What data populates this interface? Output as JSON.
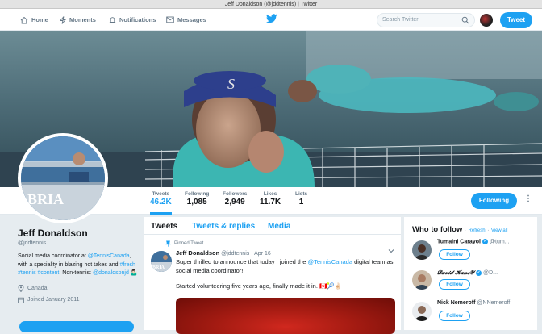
{
  "window": {
    "title": "Jeff Donaldson (@jddtennis) | Twitter"
  },
  "nav": {
    "home": "Home",
    "moments": "Moments",
    "notifications": "Notifications",
    "messages": "Messages",
    "search_placeholder": "Search Twitter",
    "tweet_button": "Tweet"
  },
  "stats": [
    {
      "label": "Tweets",
      "value": "46.2K"
    },
    {
      "label": "Following",
      "value": "1,085"
    },
    {
      "label": "Followers",
      "value": "2,949"
    },
    {
      "label": "Likes",
      "value": "11.7K"
    },
    {
      "label": "Lists",
      "value": "1"
    }
  ],
  "actions": {
    "following": "Following",
    "more": "⋮"
  },
  "profile": {
    "name": "Jeff Donaldson",
    "handle": "@jddtennis",
    "bio_1": "Social media coordinator at ",
    "bio_link_1": "@TennisCanada",
    "bio_2": ", with a speciality in blazing hot takes and ",
    "bio_link_2": "#fresh #tennis #content",
    "bio_3": ". Non-tennis: ",
    "bio_link_3": "@donaldsonjd",
    "bio_emoji": "🤷🏻‍♂️",
    "location": "Canada",
    "joined": "Joined January 2011",
    "banner_logo": "BRIA"
  },
  "timeline": {
    "tabs": [
      "Tweets",
      "Tweets & replies",
      "Media"
    ],
    "pinned_label": "Pinned Tweet",
    "tweet": {
      "name": "Jeff Donaldson",
      "handle": "@jddtennis",
      "date": "· Apr 16",
      "text_1": "Super thrilled to announce that today I joined the ",
      "text_link": "@TennisCanada",
      "text_2": " digital team as social media coordinator!",
      "text_3": "Started volunteering five years ago, finally made it in. 🇨🇦🎾✌🏻",
      "avatar_logo": "BRIA"
    }
  },
  "who_to_follow": {
    "title": "Who to follow",
    "refresh": "Refresh",
    "separator": "·",
    "view_all": "View all",
    "follow_label": "Follow",
    "suggestions": [
      {
        "name": "Tumaini Carayol",
        "handle": "@tum..."
      },
      {
        "name": "𝓓𝓪𝓿𝓲𝓭 𝓚𝓪𝓷𝓮𝓨",
        "handle": "@D..."
      },
      {
        "name": "Nick Nemeroff",
        "handle": "@NNemeroff"
      }
    ]
  },
  "colors": {
    "accent": "#1da1f2",
    "background": "#e6ecf0",
    "text": "#14171a",
    "muted": "#657786"
  }
}
